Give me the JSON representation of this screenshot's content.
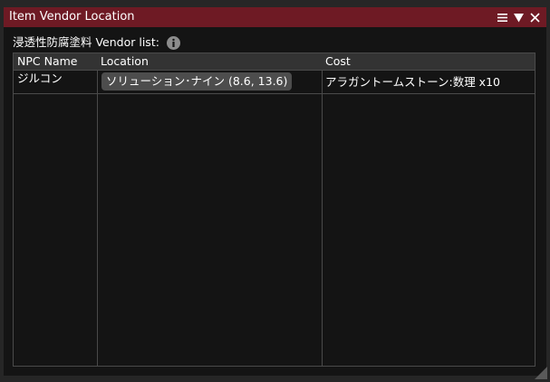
{
  "window": {
    "title": "Item Vendor Location",
    "title_bg": "#6e1a24",
    "icons": [
      "menu-icon",
      "collapse-triangle-icon",
      "close-icon"
    ]
  },
  "header": {
    "text": "浸透性防腐塗料 Vendor list:",
    "info_icon": "info-icon"
  },
  "table": {
    "columns": [
      "NPC Name",
      "Location",
      "Cost"
    ],
    "rows": [
      {
        "npc": "ジルコン",
        "location": "ソリューション･ナイン (8.6, 13.6)",
        "cost": "アラガントームストーン:数理 x10"
      }
    ]
  }
}
